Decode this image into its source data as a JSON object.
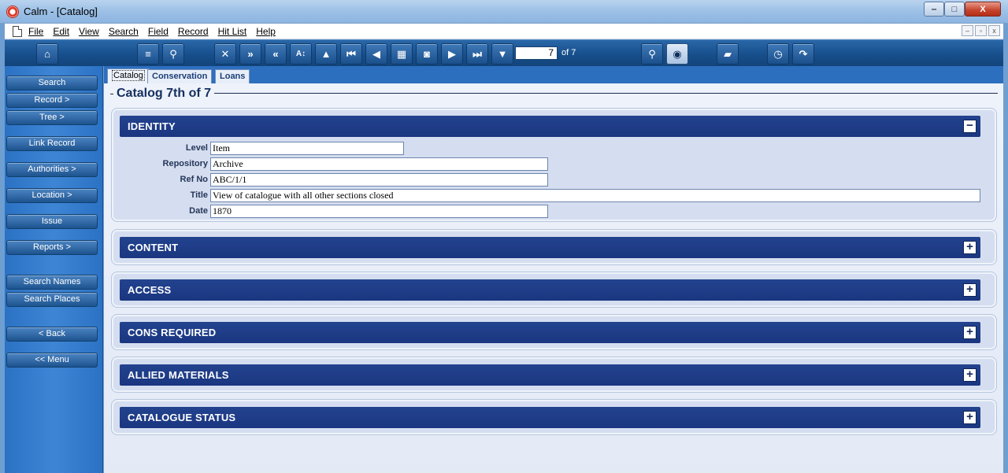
{
  "window": {
    "title": "Calm - [Catalog]",
    "controls": {
      "minimize": "‒",
      "maximize": "□",
      "close": "X"
    }
  },
  "menu": [
    "File",
    "Edit",
    "View",
    "Search",
    "Field",
    "Record",
    "Hit List",
    "Help"
  ],
  "mdi_controls": {
    "minimize": "–",
    "restore": "▫",
    "close": "x"
  },
  "toolbar": {
    "record_number": "7",
    "record_total": "of 7"
  },
  "sidebar": {
    "search": "Search",
    "record": "Record >",
    "tree": "Tree >",
    "link_record": "Link Record",
    "authorities": "Authorities >",
    "location": "Location >",
    "issue": "Issue",
    "reports": "Reports >",
    "search_names": "Search Names",
    "search_places": "Search Places",
    "back": "< Back",
    "menu": "<< Menu"
  },
  "tabs": {
    "catalog": "Catalog",
    "conservation": "Conservation",
    "loans": "Loans"
  },
  "page": {
    "title": "Catalog 7th of 7"
  },
  "identity": {
    "title": "IDENTITY",
    "toggle": "−",
    "labels": {
      "level": "Level",
      "repository": "Repository",
      "ref_no": "Ref No",
      "title": "Title",
      "date": "Date"
    },
    "values": {
      "level": "Item",
      "repository": "Archive",
      "ref_no": "ABC/1/1",
      "title": "View of catalogue with all other sections closed",
      "date": "1870"
    }
  },
  "sections": {
    "content": {
      "title": "CONTENT",
      "toggle": "+"
    },
    "access": {
      "title": "ACCESS",
      "toggle": "+"
    },
    "cons_required": {
      "title": "CONS REQUIRED",
      "toggle": "+"
    },
    "allied_materials": {
      "title": "ALLIED MATERIALS",
      "toggle": "+"
    },
    "catalogue_status": {
      "title": "CATALOGUE STATUS",
      "toggle": "+"
    }
  }
}
